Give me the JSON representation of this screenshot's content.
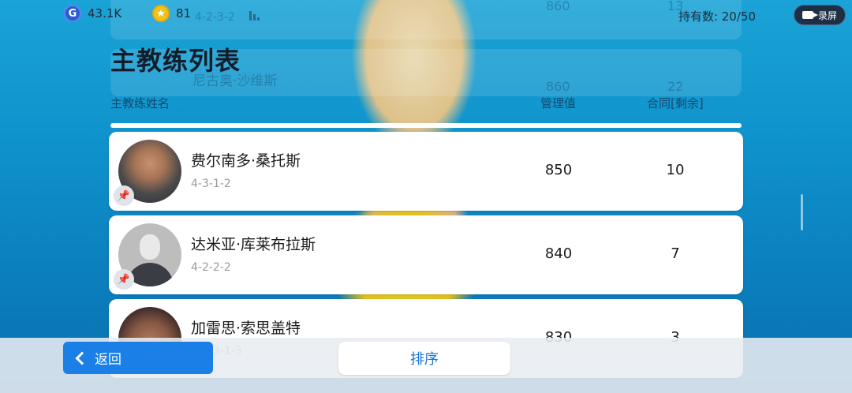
{
  "status": {
    "gp_amount": "43.1K",
    "coins_amount": "81",
    "holding_label": "持有数: 20/50",
    "record_label": "录屏"
  },
  "page_title": "主教练列表",
  "columns": {
    "name": "主教练姓名",
    "management": "管理值",
    "contract": "合同[剩余]"
  },
  "coaches": [
    {
      "name": "费尔南多·桑托斯",
      "formation": "4-3-1-2",
      "management": "850",
      "contract": "10",
      "avatar": "photo"
    },
    {
      "name": "达米亚·库莱布拉斯",
      "formation": "4-2-2-2",
      "management": "840",
      "contract": "7",
      "avatar": "silhouette"
    },
    {
      "name": "加雷思·索思盖特",
      "formation": "4-2-3-1-3",
      "management": "830",
      "contract": "3",
      "avatar": "photo"
    }
  ],
  "background_ghosts": {
    "row1_formation": "4-2-3-2",
    "row1_management": "860",
    "row1_contract": "13",
    "row2_name": "尼古奥·沙维斯",
    "row2_management": "860",
    "row2_contract": "22"
  },
  "bottom": {
    "back_label": "返回",
    "sort_label": "排序"
  },
  "colors": {
    "accent_blue": "#1a7fe6",
    "sort_text": "#1a74d6",
    "background_top": "#1aa3d6"
  },
  "icons": [
    "gp-coin-icon",
    "star-coin-icon",
    "signal-icon",
    "camera-icon",
    "pin-icon",
    "chevron-left-icon"
  ]
}
